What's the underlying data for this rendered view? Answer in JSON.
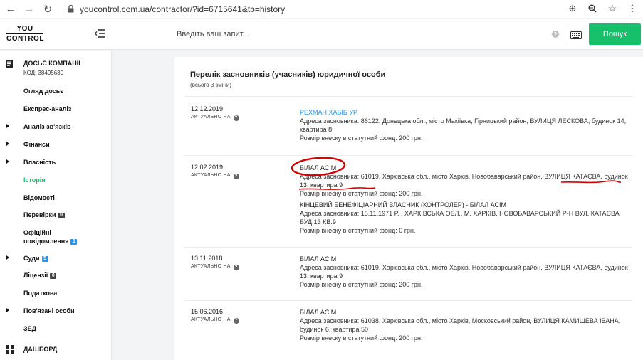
{
  "browser": {
    "url": "youcontrol.com.ua/contractor/?id=6715641&tb=history"
  },
  "header": {
    "logo_top": "YOU",
    "logo_bottom": "CONTROL",
    "search_placeholder": "Введіть ваш запит...",
    "search_button": "Пошук",
    "help_glyph": "?"
  },
  "sidebar": {
    "dossier_title": "ДОСЬЄ КОМПАНІЇ",
    "dossier_code": "КОД: 38495630",
    "items": [
      {
        "label": "Огляд досьє",
        "arrow": false,
        "active": false
      },
      {
        "label": "Експрес-аналіз",
        "arrow": false,
        "active": false
      },
      {
        "label": "Аналіз зв'язків",
        "arrow": true,
        "active": false
      },
      {
        "label": "Фінанси",
        "arrow": true,
        "active": false
      },
      {
        "label": "Власність",
        "arrow": true,
        "active": false
      },
      {
        "label": "Історія",
        "arrow": false,
        "active": true
      },
      {
        "label": "Відомості",
        "arrow": false,
        "active": false
      },
      {
        "label": "Перевірки",
        "arrow": false,
        "active": false,
        "badge": "0"
      },
      {
        "label": "Офіційні",
        "label2": "повідомлення",
        "arrow": false,
        "active": false,
        "badge": "1"
      },
      {
        "label": "Суди",
        "arrow": true,
        "active": false,
        "badge": "5"
      },
      {
        "label": "Ліцензії",
        "arrow": false,
        "active": false,
        "badge": "0"
      },
      {
        "label": "Податкова",
        "arrow": false,
        "active": false
      },
      {
        "label": "Пов'язані особи",
        "arrow": true,
        "active": false
      },
      {
        "label": "ЗЕД",
        "arrow": false,
        "active": false
      }
    ],
    "dashboard": "ДАШБОРД"
  },
  "main": {
    "title": "Перелік засновників (учасників) юридичної особи",
    "subtitle": "(всього 3 зміни)",
    "actual_label": "АКТУАЛЬНО НА",
    "records": [
      {
        "date": "12.12.2019",
        "entries": [
          {
            "name": "РЕХМАН ХАБІБ УР",
            "link": true,
            "address": "Адреса засновника: 86122, Донецька обл., місто Макіївка, Гірницький район, ВУЛИЦЯ ЛЕСКОВА, будинок 14, квартира 8",
            "capital": "Розмір внеску в статутний фонд: 200 грн."
          }
        ]
      },
      {
        "date": "12.02.2019",
        "entries": [
          {
            "name": "БІЛАЛ АСІМ",
            "link": false,
            "address": "Адреса засновника: 61019, Харківська обл., місто Харків, Новобаварський район, ВУЛИЦЯ КАТАЄВА, будинок 13, квартира 9",
            "capital": "Розмір внеску в статутний фонд: 200 грн."
          },
          {
            "name": "КІНЦЕВИЙ БЕНЕФІЦІАРНИЙ ВЛАСНИК (КОНТРОЛЕР) - БІЛАЛ АСІМ",
            "link": false,
            "address": "Адреса засновника: 15.11.1971 Р. , ХАРКІВСЬКА ОБЛ., М. ХАРКІВ, НОВОБАВАРСЬКИЙ Р-Н ВУЛ. КАТАЄВА БУД.13 КВ.9",
            "capital": "Розмір внеску в статутний фонд: 0 грн."
          }
        ]
      },
      {
        "date": "13.11.2018",
        "entries": [
          {
            "name": "БІЛАЛ АСІМ",
            "link": false,
            "address": "Адреса засновника: 61019, Харківська обл., місто Харків, Новобаварський район, ВУЛИЦЯ КАТАЄВА, будинок 13, квартира 9",
            "capital": "Розмір внеску в статутний фонд: 200 грн."
          }
        ]
      },
      {
        "date": "15.06.2016",
        "entries": [
          {
            "name": "БІЛАЛ АСІМ",
            "link": false,
            "address": "Адреса засновника: 61038, Харківська обл., місто Харків, Московський район, ВУЛИЦЯ КАМИШЕВА ІВАНА, будинок 6, квартира 50",
            "capital": "Розмір внеску в статутний фонд: 200 грн."
          }
        ]
      }
    ]
  },
  "colors": {
    "accent": "#16c06a",
    "link": "#2196f3",
    "annotation": "#d60000"
  }
}
